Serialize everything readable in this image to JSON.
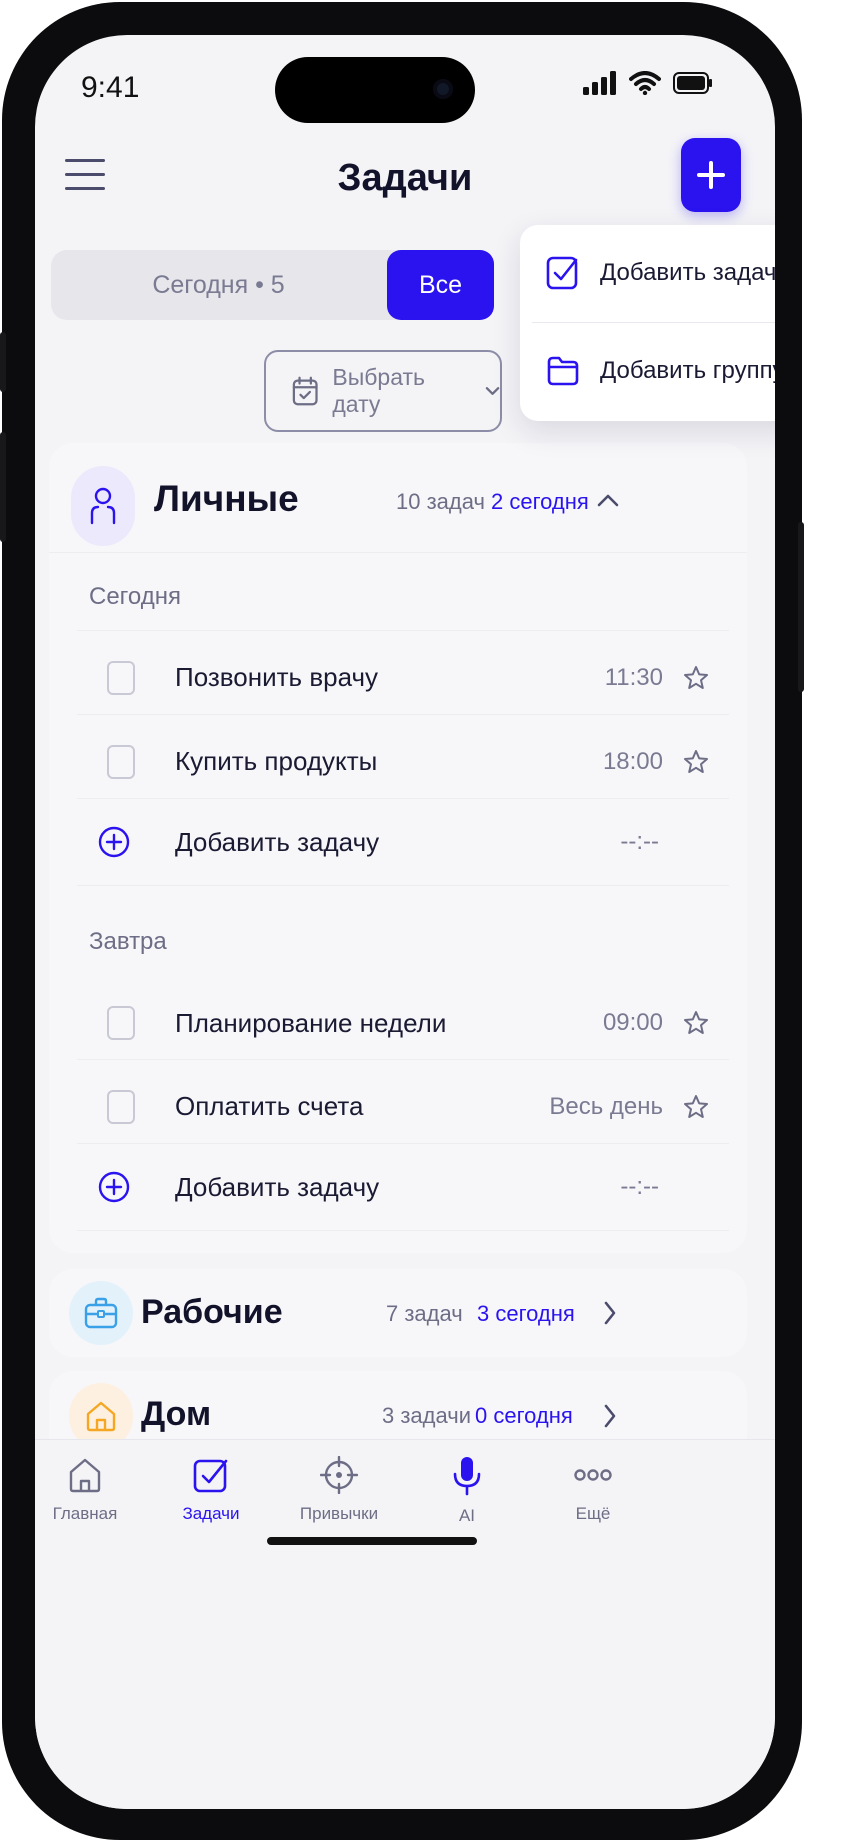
{
  "status": {
    "time": "9:41"
  },
  "header": {
    "title": "Задачи",
    "add_icon": "plus-icon",
    "menu_icon": "hamburger-icon"
  },
  "filter": {
    "today_label": "Сегодня • 5",
    "all_label": "Все",
    "selected": "Все"
  },
  "date_picker": {
    "label": "Выбрать дату"
  },
  "add_menu": {
    "items": [
      {
        "label": "Добавить задачу",
        "icon": "checkbox-icon"
      },
      {
        "label": "Добавить группу",
        "icon": "folder-icon"
      }
    ]
  },
  "groups": [
    {
      "title": "Личные",
      "count": "10 задач",
      "today": "2 сегодня",
      "expanded": true,
      "sections": [
        {
          "label": "Сегодня",
          "tasks": [
            {
              "text": "Позвонить врачу",
              "time": "11:30"
            },
            {
              "text": "Купить продукты",
              "time": "18:00"
            }
          ],
          "add_label": "Добавить задачу",
          "add_time": "--:--"
        },
        {
          "label": "Завтра",
          "tasks": [
            {
              "text": "Планирование недели",
              "time": "09:00"
            },
            {
              "text": "Оплатить счета",
              "time": "Весь день"
            }
          ],
          "add_label": "Добавить задачу",
          "add_time": "--:--"
        }
      ]
    },
    {
      "title": "Рабочие",
      "count": "7 задач",
      "today": "3 сегодня",
      "expanded": false
    },
    {
      "title": "Дом",
      "count": "3 задачи",
      "today": "0 сегодня",
      "expanded": false
    }
  ],
  "tabbar": {
    "items": [
      {
        "label": "Главная",
        "icon": "home-icon"
      },
      {
        "label": "Задачи",
        "icon": "tasks-icon",
        "active": true
      },
      {
        "label": "Привычки",
        "icon": "target-icon"
      },
      {
        "label": "AI",
        "icon": "microphone-icon"
      },
      {
        "label": "Ещё",
        "icon": "more-icon"
      }
    ]
  },
  "colors": {
    "accent": "#2a13ef",
    "background": "#f4f4f7",
    "work": "#3aa0e8",
    "home": "#f5a623"
  }
}
